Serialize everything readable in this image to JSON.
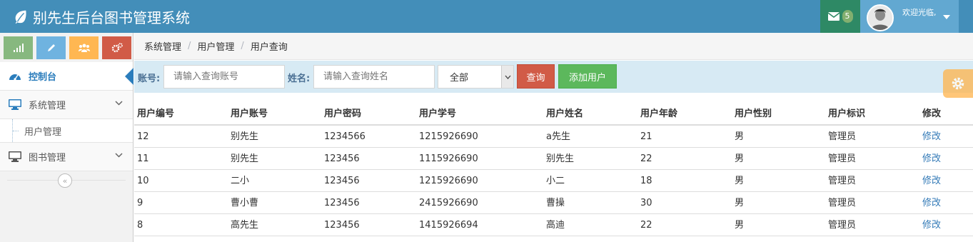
{
  "navbar": {
    "title": "别先生后台图书管理系统",
    "message_count": "5",
    "greeting": "欢迎光临,",
    "brand_color": "#438eb9"
  },
  "sidebar": {
    "shortcuts": [
      {
        "icon": "signal-icon",
        "color": "#87b87f"
      },
      {
        "icon": "pencil-icon",
        "color": "#6fb3e0"
      },
      {
        "icon": "users-icon",
        "color": "#ffb752"
      },
      {
        "icon": "cogs-icon",
        "color": "#d15b47"
      }
    ],
    "items": [
      {
        "label": "控制台",
        "icon": "dashboard-icon"
      },
      {
        "label": "系统管理",
        "icon": "desktop-icon"
      },
      {
        "label": "图书管理",
        "icon": "desktop-icon"
      }
    ],
    "submenu": {
      "label": "用户管理"
    }
  },
  "breadcrumb": [
    "系统管理",
    "用户管理",
    "用户查询"
  ],
  "search": {
    "account_label": "账号:",
    "account_placeholder": "请输入查询账号",
    "name_label": "姓名:",
    "name_placeholder": "请输入查询姓名",
    "select_value": "全部",
    "query_button": "查询",
    "add_button": "添加用户"
  },
  "table": {
    "headers": [
      "用户编号",
      "用户账号",
      "用户密码",
      "用户学号",
      "用户姓名",
      "用户年龄",
      "用户性别",
      "用户标识",
      "修改"
    ],
    "rows": [
      [
        "12",
        "别先生",
        "1234566",
        "1215926690",
        "a先生",
        "21",
        "男",
        "管理员",
        "修改"
      ],
      [
        "11",
        "别先生",
        "123456",
        "1115926690",
        "别先生",
        "22",
        "男",
        "管理员",
        "修改"
      ],
      [
        "10",
        "二小",
        "123456",
        "1215926690",
        "小二",
        "18",
        "男",
        "管理员",
        "修改"
      ],
      [
        "9",
        "曹小曹",
        "123456",
        "2415926690",
        "曹操",
        "30",
        "男",
        "管理员",
        "修改"
      ],
      [
        "8",
        "高先生",
        "123456",
        "1415926694",
        "高迪",
        "22",
        "男",
        "管理员",
        "修改"
      ]
    ]
  }
}
